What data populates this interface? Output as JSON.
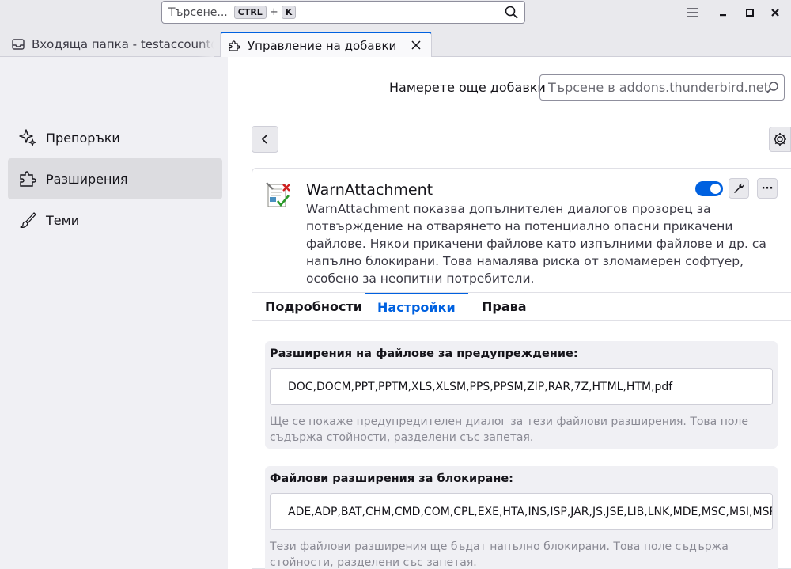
{
  "titlebar": {
    "search_placeholder": "Търсене...",
    "kbd_ctrl": "CTRL",
    "kbd_plus": "+",
    "kbd_k": "K"
  },
  "tabs": [
    {
      "label": "Входяща папка - testaccount@jd"
    },
    {
      "label": "Управление на добавки"
    }
  ],
  "sidebar": {
    "items": [
      {
        "label": "Препоръки"
      },
      {
        "label": "Разширения"
      },
      {
        "label": "Теми"
      }
    ]
  },
  "main": {
    "find_more": "Намерете още добавки",
    "amo_search_placeholder": "Търсене в addons.thunderbird.net"
  },
  "addon": {
    "name": "WarnAttachment",
    "description": "WarnAttachment показва допълнителен диалогов прозорец за потвърждение на отварянето на потенциално опасни прикачени файлове. Някои прикачени файлове като изпълними файлове и др. са напълно блокирани. Това намалява риска от зломамерен софтуер, особено за неопитни потребители.",
    "enabled": true,
    "more_label": "···"
  },
  "detail_tabs": [
    {
      "label": "Подробности"
    },
    {
      "label": "Настройки"
    },
    {
      "label": "Права"
    }
  ],
  "prefs": [
    {
      "label": "Разширения на файлове за предупреждение:",
      "value": "DOC,DOCM,PPT,PPTM,XLS,XLSM,PPS,PPSM,ZIP,RAR,7Z,HTML,HTM,pdf",
      "hint": "Ще се покаже предупредителен диалог за тези файлови разширения. Това поле съдържа стойности, разделени със запетая."
    },
    {
      "label": "Файлови разширения за блокиране:",
      "value": "ADE,ADP,BAT,CHM,CMD,COM,CPL,EXE,HTA,INS,ISP,JAR,JS,JSE,LIB,LNK,MDE,MSC,MSI,MSP,",
      "hint": "Тези файлови разширения ще бъдат напълно блокирани. Това поле съдържа стойности, разделени със запетая."
    }
  ],
  "colors": {
    "accent": "#0061e0",
    "sidebar_bg": "#f0f0f4",
    "selected_bg": "#dcdce0"
  }
}
